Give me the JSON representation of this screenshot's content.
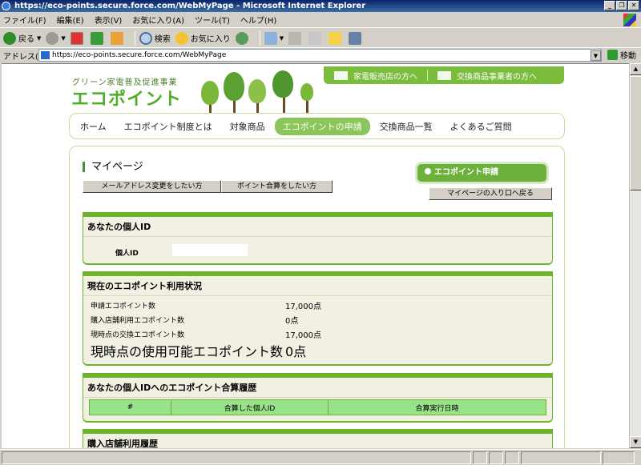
{
  "window": {
    "title": "https://eco-points.secure.force.com/WebMyPage - Microsoft Internet Explorer",
    "min": "_",
    "max": "❐",
    "close": "✕"
  },
  "menu": [
    "ファイル(F)",
    "編集(E)",
    "表示(V)",
    "お気に入り(A)",
    "ツール(T)",
    "ヘルプ(H)"
  ],
  "toolbar": {
    "back": "戻る",
    "search": "検索",
    "favorites": "お気に入り"
  },
  "address": {
    "label": "アドレス(D)",
    "url": "https://eco-points.secure.force.com/WebMyPage",
    "go": "移動"
  },
  "site": {
    "subtitle": "グリーン家電普及促進事業",
    "logo": "エコポイント",
    "tree_color": "#7ab83a"
  },
  "topbar": {
    "retailer": "家電販売店の方へ",
    "exchange": "交換商品事業者の方へ"
  },
  "nav": [
    "ホーム",
    "エコポイント制度とは",
    "対象商品",
    "エコポイントの申請",
    "交換商品一覧",
    "よくあるご質問"
  ],
  "mypage": {
    "title": "マイページ",
    "btn_email": "メールアドレス変更をしたい方",
    "btn_merge": "ポイント合算をしたい方",
    "apply": "エコポイント申請",
    "back": "マイページの入り口へ戻る"
  },
  "personal": {
    "title": "あなたの個人ID",
    "id_label": "個人ID"
  },
  "status": {
    "title": "現在のエコポイント利用状況",
    "rows": [
      {
        "label": "申請エコポイント数",
        "value": "17,000点"
      },
      {
        "label": "購入店舗利用エコポイント数",
        "value": "0点"
      },
      {
        "label": "現時点の交換エコポイント数",
        "value": "17,000点"
      }
    ],
    "available_label": "現時点の使用可能エコポイント数",
    "available_value": "0点"
  },
  "history": {
    "title": "あなたの個人IDへのエコポイント合算履歴",
    "cols": [
      "#",
      "合算した個人ID",
      "合算実行日時"
    ]
  },
  "store": {
    "title": "購入店舗利用履歴"
  }
}
